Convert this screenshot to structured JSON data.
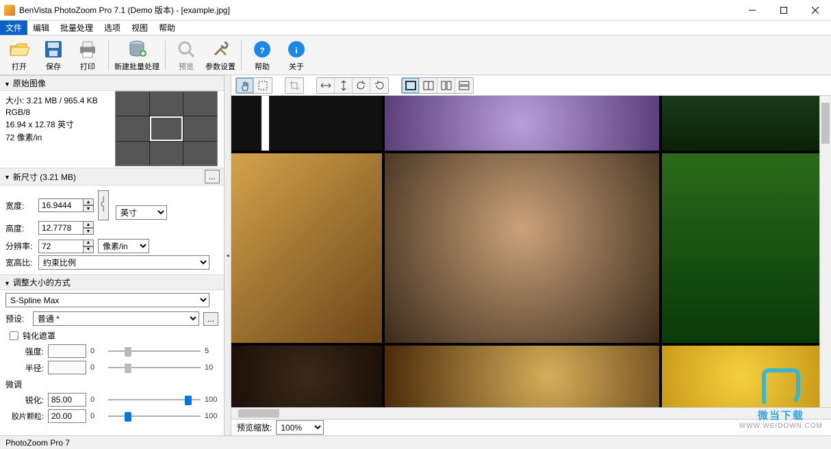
{
  "window": {
    "title": "BenVista PhotoZoom Pro 7.1 (Demo 版本) - [example.jpg]"
  },
  "menu": {
    "file": "文件",
    "edit": "编辑",
    "batch": "批量处理",
    "options": "选项",
    "view": "视图",
    "help": "帮助"
  },
  "toolbar": {
    "open": "打开",
    "save": "保存",
    "print": "打印",
    "new_batch": "新建批量处理",
    "preview": "预览",
    "settings": "参数设置",
    "help": "帮助",
    "about": "关于"
  },
  "original": {
    "header": "原始图像",
    "size_line": "大小: 3.21 MB / 965.4 KB",
    "mode": "RGB/8",
    "dims": "16.94 x 12.78 英寸",
    "res": "72 像素/in"
  },
  "newsize": {
    "header": "新尺寸 (3.21 MB)",
    "width_label": "宽度:",
    "width_value": "16.9444",
    "height_label": "高度:",
    "height_value": "12.7778",
    "unit": "英寸",
    "res_label": "分辨率:",
    "res_value": "72",
    "res_unit": "像素/in",
    "ratio_label": "宽高比:",
    "ratio_value": "约束比例"
  },
  "resize": {
    "header": "调整大小的方式",
    "method": "S-Spline Max",
    "preset_label": "预设:",
    "preset_value": "普通 *",
    "unsharp_chk": "钝化遮罩",
    "strength_label": "强度:",
    "strength_value": "",
    "strength_min": "0",
    "strength_max": "5",
    "radius_label": "半径:",
    "radius_value": "",
    "radius_min": "0",
    "radius_max": "10",
    "finetune_label": "微调",
    "sharp_label": "锐化:",
    "sharp_value": "85.00",
    "sharp_min": "0",
    "sharp_max": "100",
    "grain_label": "胶片颗粒:",
    "grain_value": "20.00",
    "grain_min": "0",
    "grain_max": "100"
  },
  "zoom": {
    "label": "预览缩放:",
    "value": "100%"
  },
  "status": {
    "text": "PhotoZoom Pro 7"
  },
  "watermark": {
    "line1": "微当下载",
    "line2": "WWW.WEIDOWN.COM"
  }
}
